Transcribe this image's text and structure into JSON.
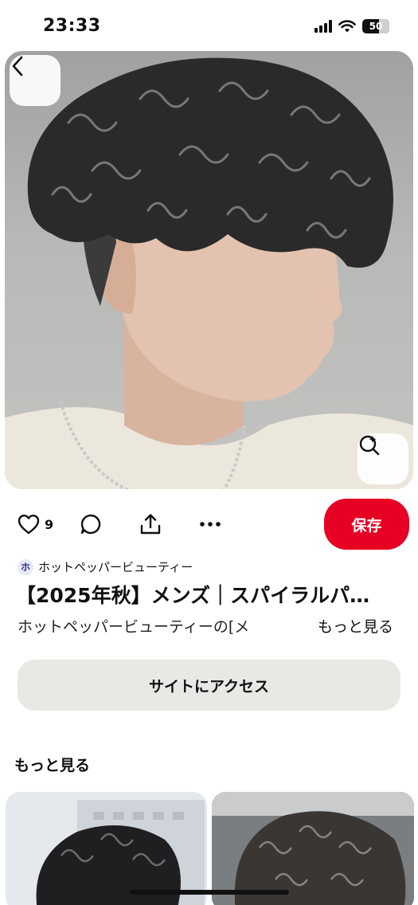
{
  "status_bar": {
    "time": "23:33",
    "battery": "50",
    "icons": [
      "signal-icon",
      "wifi-icon",
      "battery-icon"
    ]
  },
  "pin": {
    "image_alt": "curly spiral perm men's hairstyle",
    "like_count": "9",
    "save_label": "保存",
    "source_initial": "ホ",
    "source_name": "ホットペッパービューティー",
    "title": "【2025年秋】メンズ｜スパイラルパ…",
    "description": "ホットペッパービューティーの[メ",
    "more_link": "もっと見る",
    "visit_label": "サイトにアクセス"
  },
  "section": {
    "more_title": "もっと見る"
  },
  "colors": {
    "accent": "#e60023",
    "button_gray": "#e8e8e5"
  }
}
